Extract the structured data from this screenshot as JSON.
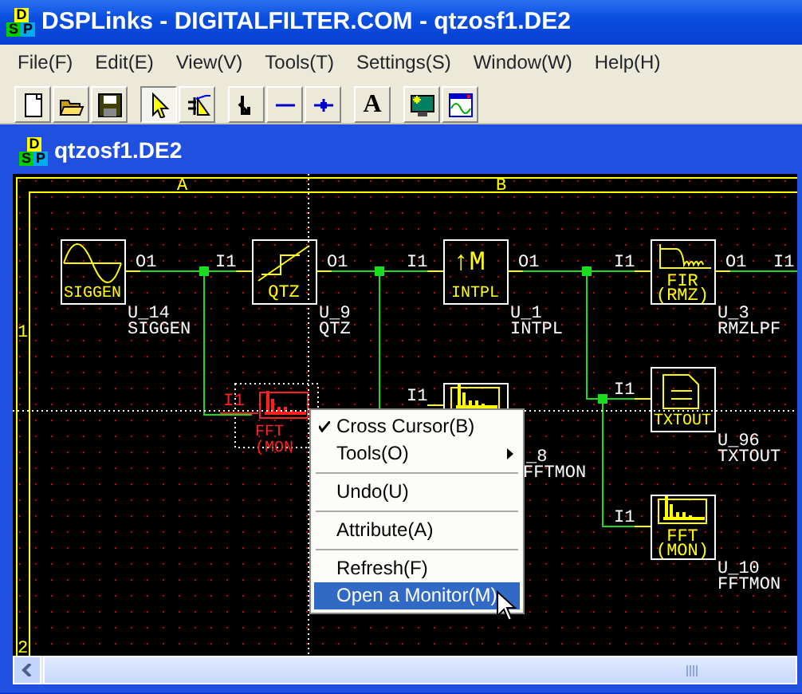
{
  "window": {
    "title": "DSPLinks - DIGITALFILTER.COM - qtzosf1.DE2",
    "logo": [
      "D",
      "S",
      "P"
    ]
  },
  "menu_bar": [
    "File(F)",
    "Edit(E)",
    "View(V)",
    "Tools(T)",
    "Settings(S)",
    "Window(W)",
    "Help(H)"
  ],
  "toolbar": {
    "groups": [
      [
        {
          "pressed": false
        },
        {
          "pressed": false
        },
        {
          "pressed": false
        }
      ],
      [
        {
          "pressed": true
        },
        {
          "pressed": false
        }
      ],
      [
        {
          "pressed": false
        },
        {
          "pressed": false
        },
        {
          "pressed": false
        }
      ],
      [
        {
          "pressed": false,
          "text": "A"
        }
      ],
      [
        {
          "pressed": false
        },
        {
          "pressed": false
        }
      ]
    ]
  },
  "document": {
    "title": "qtzosf1.DE2",
    "logo": [
      "D",
      "S",
      "P"
    ],
    "diagram": {
      "columns": [
        "A",
        "B"
      ],
      "rows": [
        "1",
        "2"
      ],
      "blocks": [
        {
          "kind": "siggen",
          "caption": [
            "SIGGEN"
          ],
          "output": "O1",
          "ref": "U_14",
          "name": "SIGGEN",
          "selected": false
        },
        {
          "kind": "qtz",
          "caption": [
            "QTZ"
          ],
          "input": "I1",
          "output": "O1",
          "ref": "U_9",
          "name": "QTZ",
          "selected": false
        },
        {
          "kind": "intpl",
          "symbol": "↑M",
          "caption": [
            "INTPL"
          ],
          "input": "I1",
          "output": "O1",
          "ref": "U_1",
          "name": "INTPL",
          "selected": false
        },
        {
          "kind": "fir",
          "caption": [
            "FIR",
            "(RMZ)"
          ],
          "input": "I1",
          "output": "O1",
          "ref": "U_3",
          "name": "RMZLPF",
          "selected": false
        },
        {
          "kind": "fft",
          "caption": [
            "FFT",
            "(MON"
          ],
          "input": "I1",
          "selected": true
        },
        {
          "kind": "fft",
          "input": "I1",
          "ref": "_8",
          "name": "FFTMON",
          "selected": false
        },
        {
          "kind": "txtout",
          "caption": [
            "TXTOUT"
          ],
          "input": "I1",
          "ref": "U_96",
          "name": "TXTOUT",
          "selected": false
        },
        {
          "kind": "fft",
          "caption": [
            "FFT",
            "(MON)"
          ],
          "input": "I1",
          "ref": "U_10",
          "name": "FFTMON",
          "selected": false
        }
      ],
      "edge_port": "I1"
    },
    "context_menu": [
      {
        "kind": "item",
        "label": "Cross Cursor(B)",
        "checked": true,
        "submenu": false,
        "selected": false
      },
      {
        "kind": "item",
        "label": "Tools(O)",
        "checked": false,
        "submenu": true,
        "selected": false
      },
      {
        "kind": "separator"
      },
      {
        "kind": "item",
        "label": "Undo(U)",
        "checked": false,
        "submenu": false,
        "selected": false
      },
      {
        "kind": "separator"
      },
      {
        "kind": "item",
        "label": "Attribute(A)",
        "checked": false,
        "submenu": false,
        "selected": false
      },
      {
        "kind": "separator"
      },
      {
        "kind": "item",
        "label": "Refresh(F)",
        "checked": false,
        "submenu": false,
        "selected": false
      },
      {
        "kind": "item",
        "label": "Open a Monitor(M)",
        "checked": false,
        "submenu": false,
        "selected": true
      }
    ]
  }
}
